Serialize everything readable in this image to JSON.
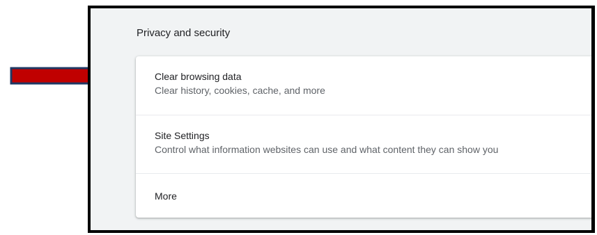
{
  "section": {
    "title": "Privacy and security"
  },
  "items": [
    {
      "label": "Clear browsing data",
      "description": "Clear history, cookies, cache, and more"
    },
    {
      "label": "Site Settings",
      "description": "Control what information websites can use and what content they can show you"
    },
    {
      "label": "More"
    }
  ],
  "annotation": {
    "icon": "right-arrow-icon",
    "color": "#c00000",
    "outline": "#1f3864"
  }
}
